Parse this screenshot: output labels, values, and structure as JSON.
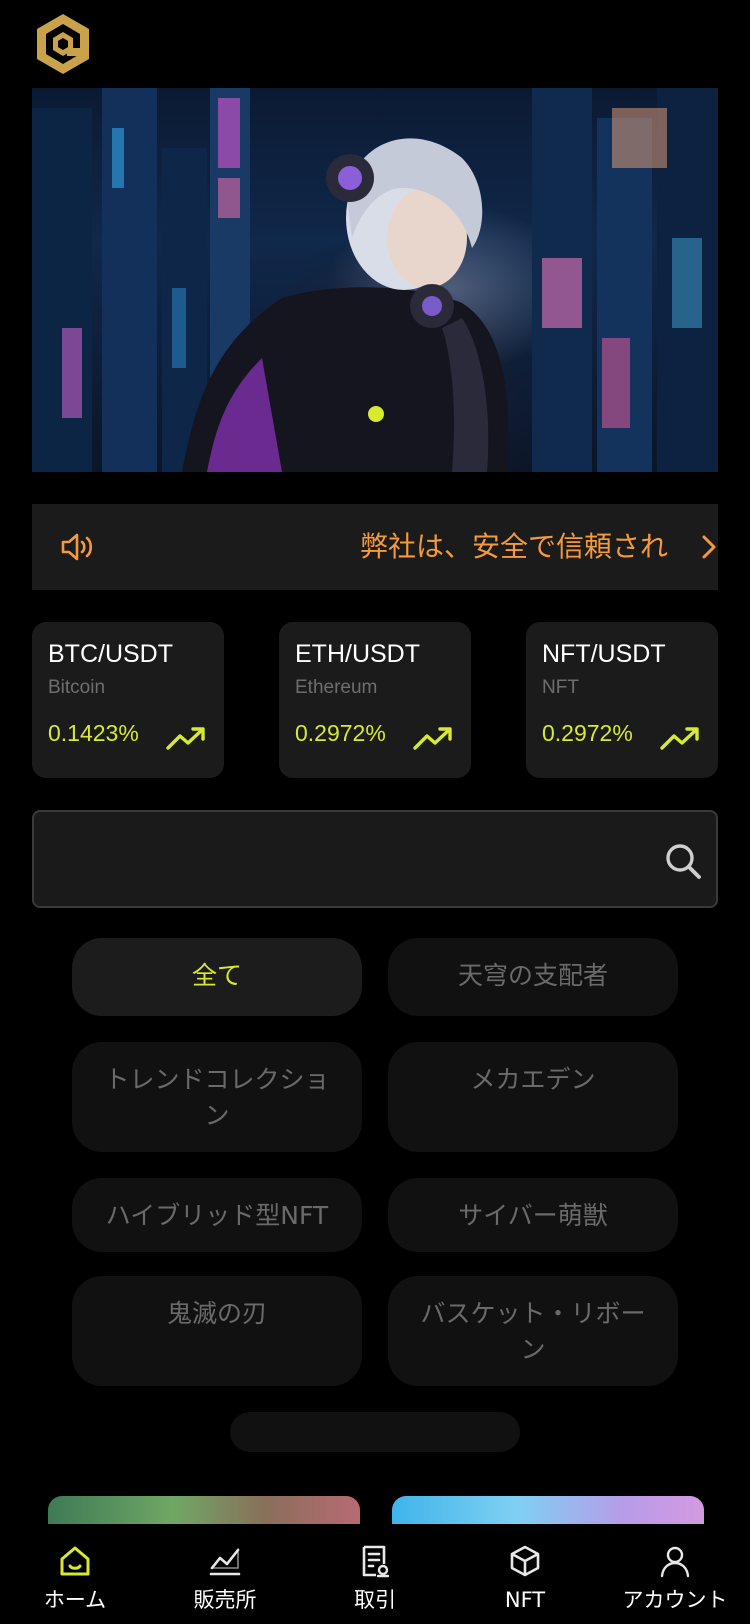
{
  "header": {
    "logo_icon": "hexagon-logo-icon",
    "brand_color": "#c9a24a"
  },
  "banner": {
    "carousel_active_index": 0,
    "indicator_color": "#d7ea2b"
  },
  "notice": {
    "icon": "speaker-icon",
    "text": "弊社は、安全で信頼され",
    "arrow_icon": "chevron-right-icon",
    "color": "#f59a3c"
  },
  "tickers": [
    {
      "pair": "BTC/USDT",
      "name": "Bitcoin",
      "change": "0.1423%",
      "trend_icon": "trend-up-icon"
    },
    {
      "pair": "ETH/USDT",
      "name": "Ethereum",
      "change": "0.2972%",
      "trend_icon": "trend-up-icon"
    },
    {
      "pair": "NFT/USDT",
      "name": "NFT",
      "change": "0.2972%",
      "trend_icon": "trend-up-icon"
    }
  ],
  "search": {
    "value": "",
    "placeholder": "",
    "icon": "search-icon"
  },
  "categories": [
    {
      "label": "全て",
      "active": true
    },
    {
      "label": "天穹の支配者",
      "active": false
    },
    {
      "label": "トレンドコレクション",
      "active": false
    },
    {
      "label": "メカエデン",
      "active": false
    },
    {
      "label": "ハイブリッド型NFT",
      "active": false
    },
    {
      "label": "サイバー萌獣",
      "active": false
    },
    {
      "label": "鬼滅の刃",
      "active": false
    },
    {
      "label": "バスケット・リボーン",
      "active": false
    }
  ],
  "accent_color": "#d7ea2b",
  "nav": [
    {
      "label": "ホーム",
      "icon": "home-icon",
      "active": true
    },
    {
      "label": "販売所",
      "icon": "chart-icon",
      "active": false
    },
    {
      "label": "取引",
      "icon": "document-icon",
      "active": false
    },
    {
      "label": "NFT",
      "icon": "cube-icon",
      "active": false
    },
    {
      "label": "アカウント",
      "icon": "user-icon",
      "active": false
    }
  ]
}
